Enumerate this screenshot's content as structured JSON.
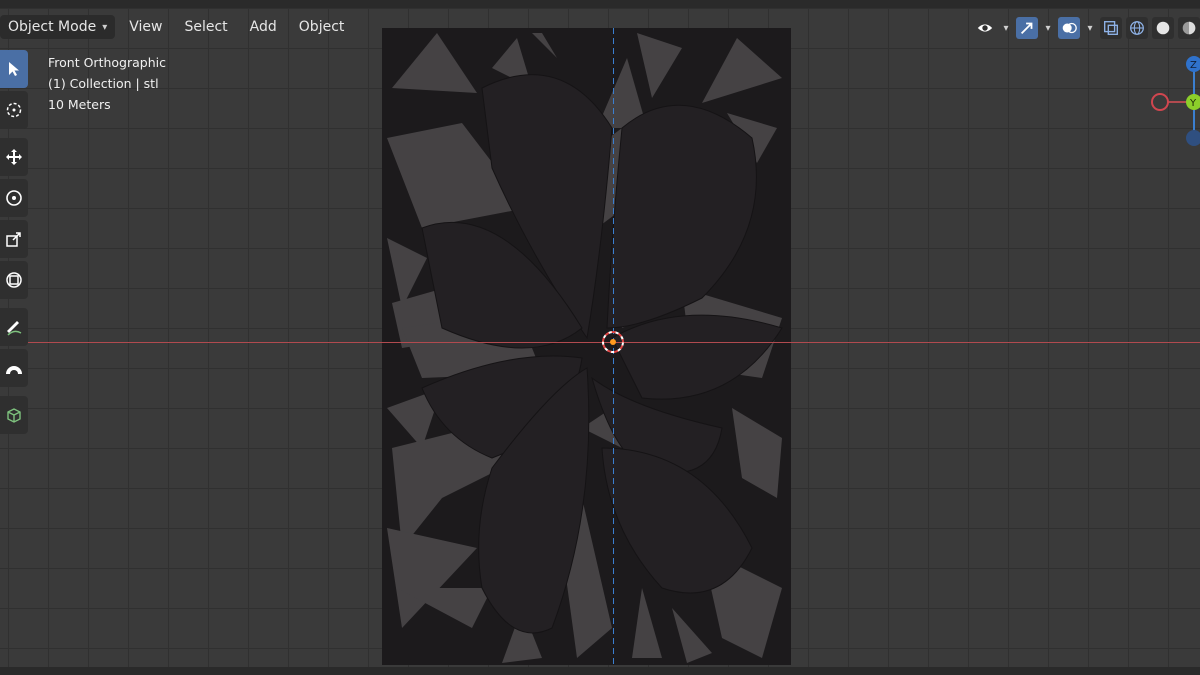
{
  "header": {
    "mode_label": "Object Mode",
    "menu": [
      "View",
      "Select",
      "Add",
      "Object"
    ]
  },
  "overlay": {
    "view_name": "Front Orthographic",
    "collection": "(1) Collection | stl",
    "scale": "10 Meters"
  },
  "gizmo": {
    "z_label": "Z",
    "y_label": "Y"
  },
  "colors": {
    "x_axis": "#b14a4f",
    "z_axis": "#3b7fd0",
    "active_tool": "#4a6fa5",
    "origin": "#ff9a1f"
  }
}
